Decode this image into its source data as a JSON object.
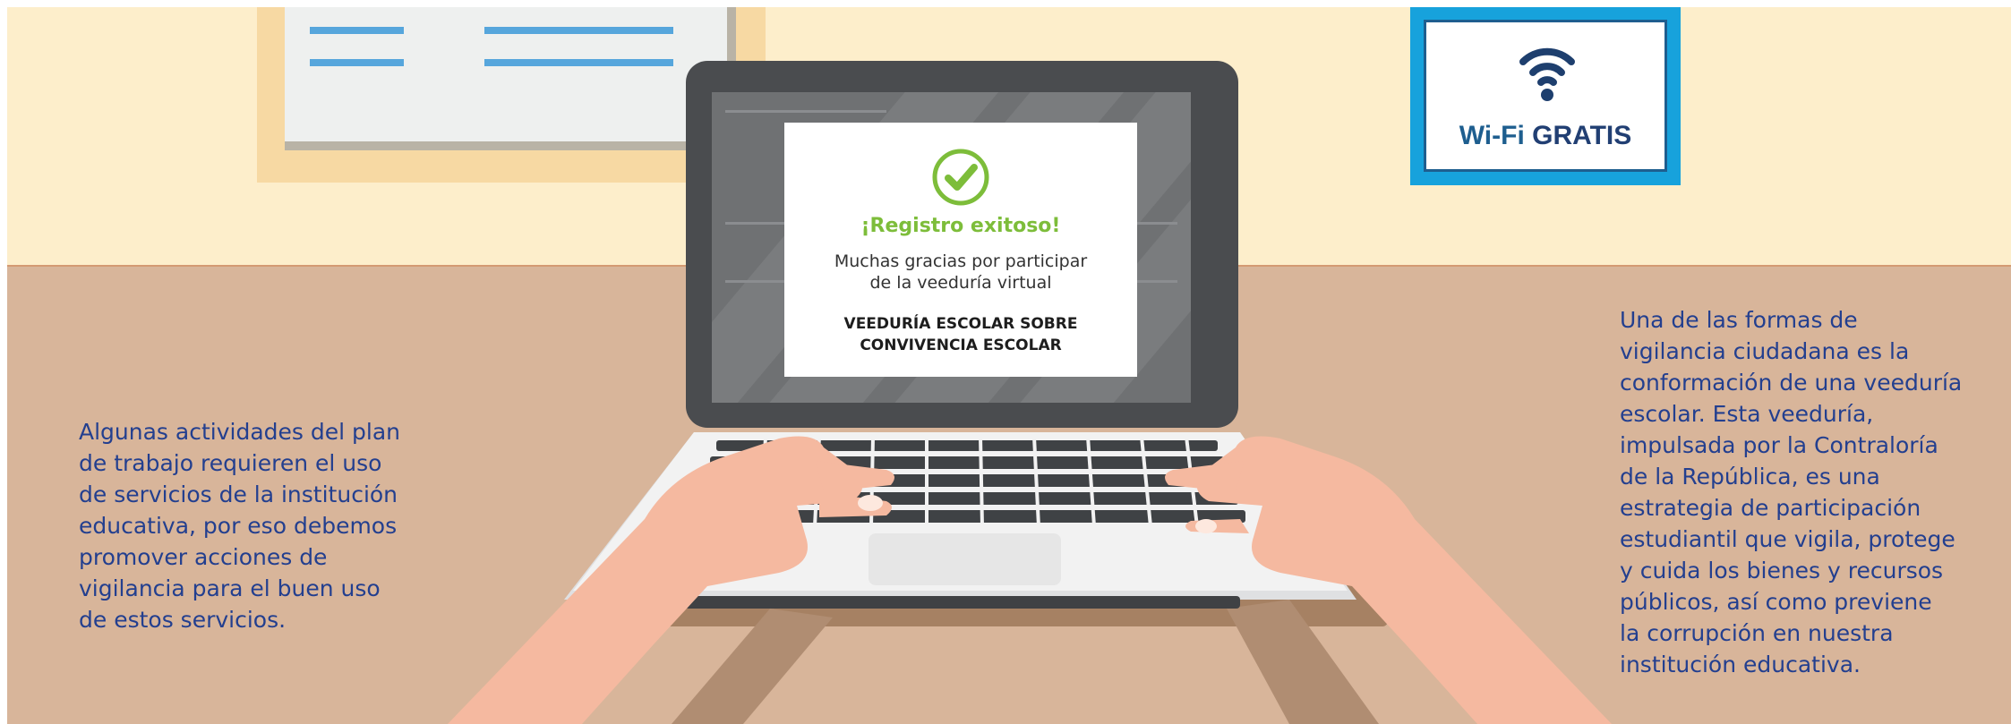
{
  "wifi_sign": {
    "icon": "wifi-icon",
    "label_part1": "Wi-Fi",
    "label_part2": "GRATIS"
  },
  "laptop_screen": {
    "status_icon": "check-circle-icon",
    "title": "¡Registro exitoso!",
    "message_line1": "Muchas gracias por participar",
    "message_line2": "de la veeduría virtual",
    "subtitle_line1": "VEEDURÍA ESCOLAR SOBRE",
    "subtitle_line2": "CONVIVENCIA ESCOLAR"
  },
  "left_text": {
    "lines": [
      "Algunas actividades del plan",
      "de trabajo requieren el uso",
      "de servicios de la institución",
      "educativa, por eso debemos",
      "promover acciones de",
      "vigilancia para el buen uso",
      "de estos servicios."
    ]
  },
  "right_text": {
    "lines": [
      "Una de las formas de",
      "vigilancia ciudadana es la",
      "conformación de una veeduría",
      "escolar. Esta veeduría,",
      "impulsada por la Contraloría",
      "de la República, es una",
      "estrategia de participación",
      "estudiantil que vigila, protege",
      "y cuida los bienes y recursos",
      "públicos, así como previene",
      "la corrupción en nuestra",
      "institución educativa."
    ]
  },
  "colors": {
    "wall": "#fdeecb",
    "desk": "#d8b59a",
    "text": "#233f8f",
    "wifi_blue": "#17a2dc",
    "success_green": "#7dbd3a"
  }
}
